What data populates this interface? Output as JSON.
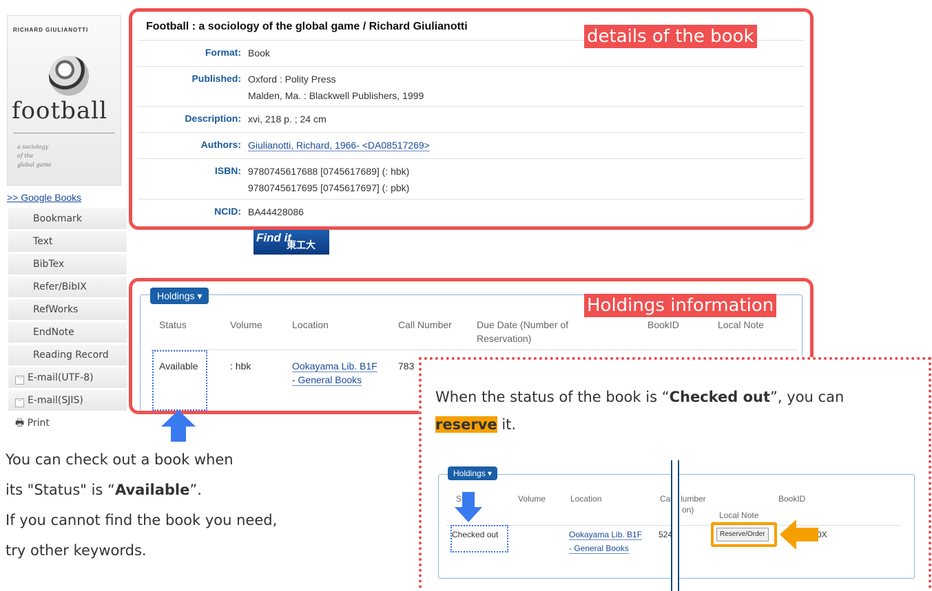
{
  "cover": {
    "author": "RICHARD GIULIANOTTI",
    "title": "football",
    "subtitle": "a sociology\nof the\nglobal game"
  },
  "sidebar": {
    "google_books": ">> Google Books",
    "items": [
      {
        "label": "Bookmark"
      },
      {
        "label": "Text"
      },
      {
        "label": "BibTex"
      },
      {
        "label": "Refer/BibIX"
      },
      {
        "label": "RefWorks"
      },
      {
        "label": "EndNote"
      },
      {
        "label": "Reading Record"
      },
      {
        "label": "E-mail(UTF-8)"
      },
      {
        "label": "E-mail(SJIS)"
      },
      {
        "label": "Print"
      }
    ]
  },
  "details": {
    "title": "Football : a sociology of the global game / Richard Giulianotti",
    "label": "details of the book",
    "rows": [
      {
        "label": "Format:",
        "values": [
          "Book"
        ]
      },
      {
        "label": "Published:",
        "values": [
          "Oxford : Polity Press",
          "Malden, Ma. : Blackwell Publishers, 1999"
        ]
      },
      {
        "label": "Description:",
        "values": [
          "xvi, 218 p. ; 24 cm"
        ]
      },
      {
        "label": "Authors:",
        "values": [
          "Giulianotti, Richard, 1966- <DA08517269>"
        ]
      },
      {
        "label": "ISBN:",
        "values": [
          "9780745617688 [0745617689] (: hbk)",
          "9780745617695 [0745617697] (: pbk)"
        ]
      },
      {
        "label": "NCID:",
        "values": [
          "BA44428086"
        ]
      }
    ]
  },
  "findit": {
    "text": "Find it",
    "kanji": "東工大"
  },
  "holdings": {
    "button": "Holdings ▾",
    "label": "Holdings information",
    "headers": [
      "Status",
      "Volume",
      "Location",
      "Call Number",
      "Due Date (Number of Reservation)",
      "BookID",
      "Local Note"
    ],
    "row": {
      "status": "Available",
      "volume": ": hbk",
      "location": [
        "Ookayama Lib. B1F",
        "- General Books"
      ],
      "call_number": "783"
    }
  },
  "instructions": [
    "You can check out a book when",
    "its \"Status\" is “Available”.",
    "If you cannot find the book you need,",
    "try other keywords."
  ],
  "instructions_bold": "Available",
  "popup": {
    "text_parts": [
      "When the status of the book is “",
      "Checked out",
      "”, you can",
      "reserve",
      " it."
    ],
    "mini": {
      "button": "Holdings ▾",
      "headers": [
        "Stat",
        "Volume",
        "Location",
        "Ca",
        "lumber",
        "on)",
        "BookID",
        "Local Note"
      ],
      "status": "Checked out",
      "location": [
        "Ookayama Lib. B1F",
        "- General Books"
      ],
      "call": "524",
      "reserve": "Reserve/Order",
      "bookid_tail": "0X"
    }
  },
  "colors": {
    "red": "#f05050",
    "blue": "#1a5fa8",
    "orange": "#f5a000",
    "arrow_blue": "#3a7af0"
  }
}
